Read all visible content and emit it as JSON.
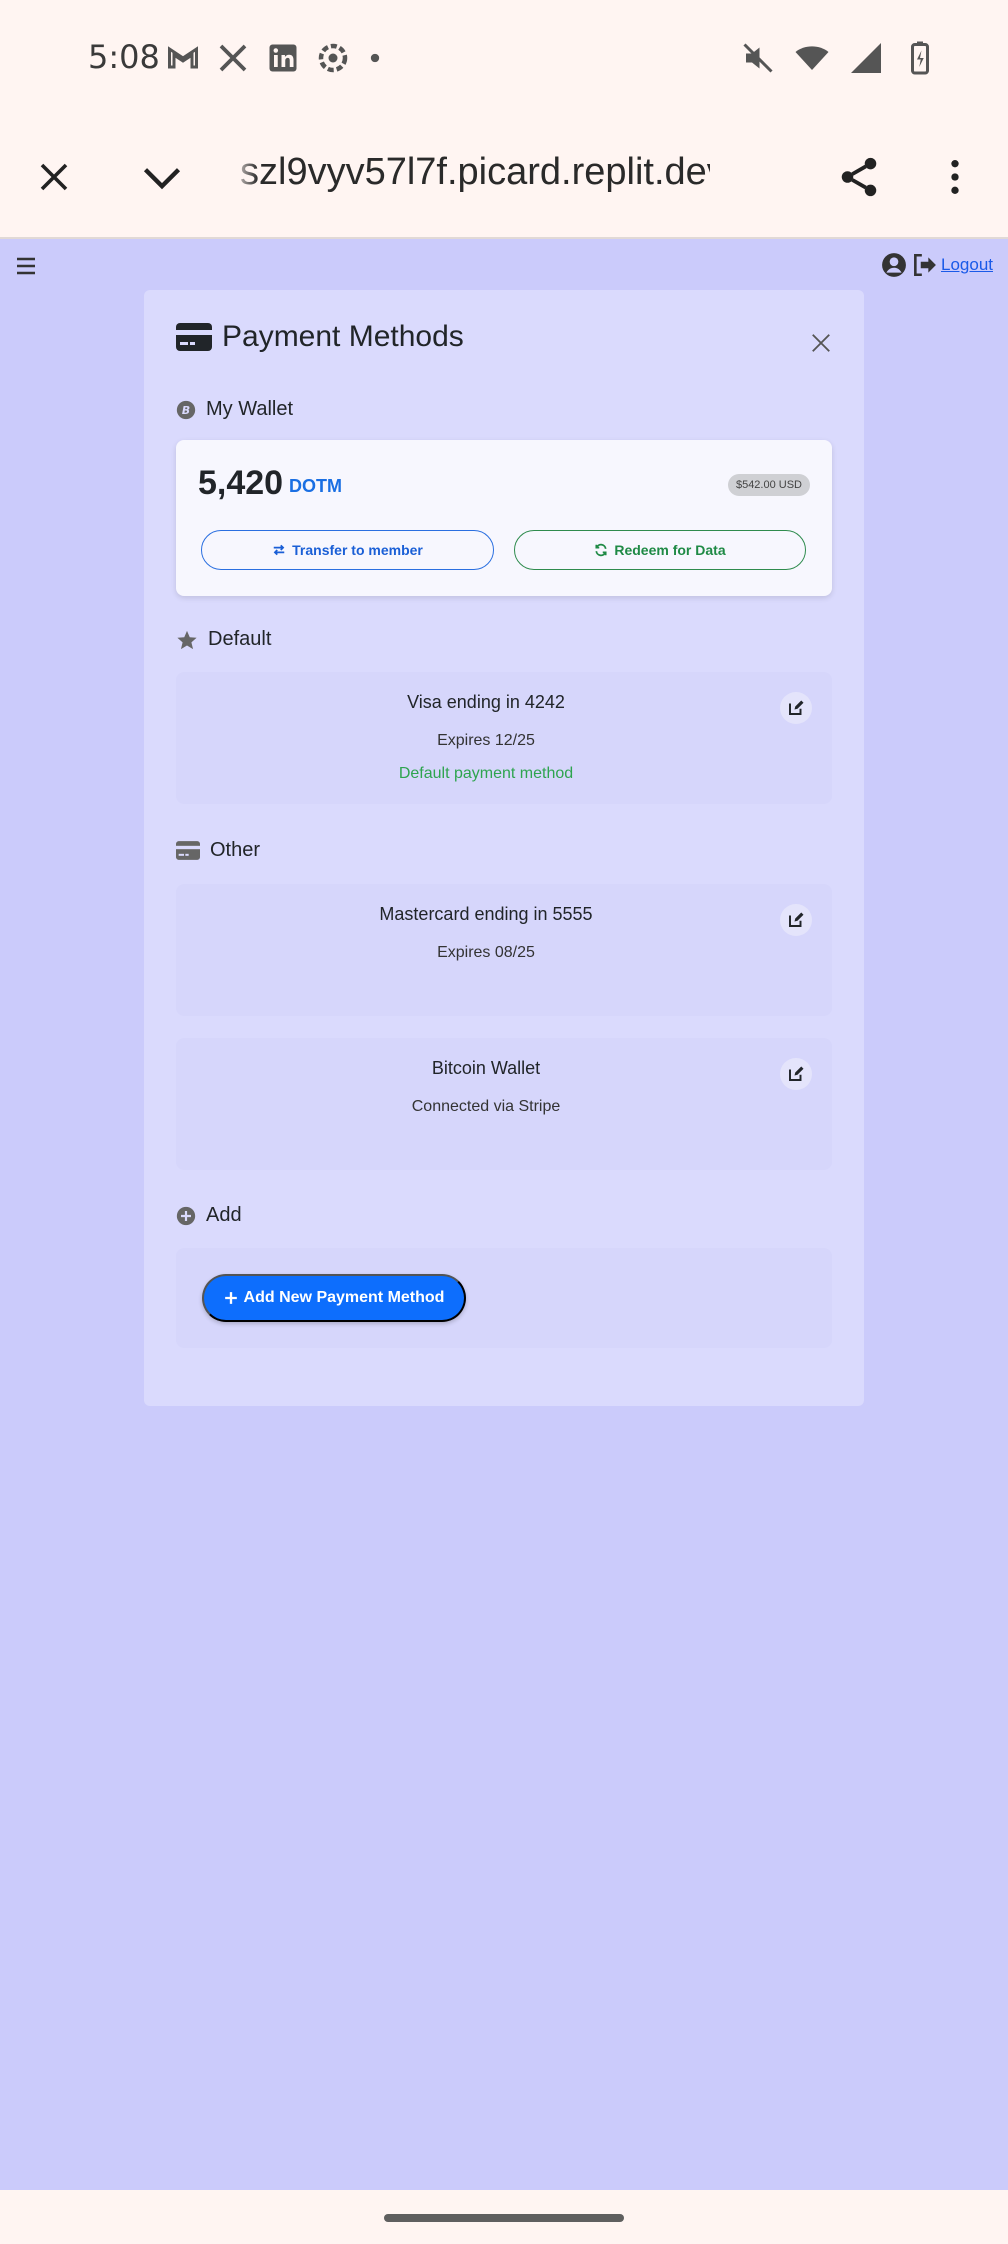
{
  "status_bar": {
    "time": "5:08",
    "left_icons": [
      "gmail-icon",
      "x-icon",
      "linkedin-icon",
      "settings-cloud-icon",
      "dot-icon"
    ],
    "right_icons": [
      "mute-icon",
      "wifi-icon",
      "signal-icon",
      "battery-charging-icon"
    ]
  },
  "browser": {
    "url": "szl9vyv57l7f.picard.replit.dev",
    "close_icon": "close-icon",
    "tabs_icon": "chevron-down-icon",
    "share_icon": "share-icon",
    "menu_icon": "more-vert-icon"
  },
  "topbar": {
    "logout_label": "Logout"
  },
  "panel": {
    "title": "Payment Methods",
    "wallet_section": "My Wallet",
    "wallet": {
      "amount": "5,420",
      "unit": "DOTM",
      "usd": "$542.00 USD",
      "transfer_label": "Transfer to member",
      "redeem_label": "Redeem for Data"
    },
    "default_section": "Default",
    "default_card": {
      "name": "Visa ending in 4242",
      "expires": "Expires 12/25",
      "note": "Default payment method"
    },
    "other_section": "Other",
    "other_cards": [
      {
        "name": "Mastercard ending in 5555",
        "sub": "Expires 08/25"
      },
      {
        "name": "Bitcoin Wallet",
        "sub": "Connected via Stripe"
      }
    ],
    "add_section": "Add",
    "add_button_label": "Add New Payment Method"
  },
  "colors": {
    "page_bg": "#cbcbfb",
    "panel_bg": "#dadafd",
    "primary": "#0d6efd",
    "success": "#2ea44f"
  }
}
